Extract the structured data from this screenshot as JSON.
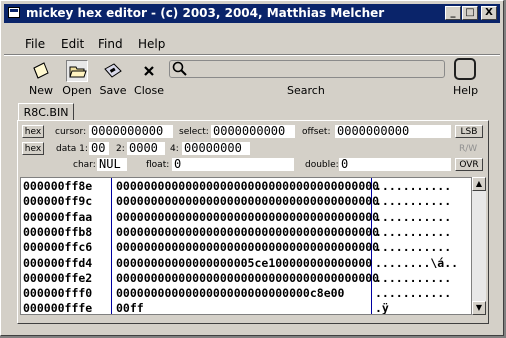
{
  "window": {
    "title": "mickey hex editor - (c) 2003, 2004, Matthias Melcher"
  },
  "title_buttons": [
    "_",
    "□",
    "X"
  ],
  "menu": [
    "File",
    "Edit",
    "Find",
    "Help"
  ],
  "toolbar": {
    "new": "New",
    "open": "Open",
    "save": "Save",
    "close": "Close",
    "search_label": "Search",
    "search_value": "",
    "help": "Help"
  },
  "tab": {
    "label": "R8C.BIN"
  },
  "fields": {
    "hex_button": "hex",
    "hex_button2": "hex",
    "cursor_label": "cursor:",
    "cursor_value": "0000000000",
    "select_label": "select:",
    "select_value": "0000000000",
    "offset_label": "offset:",
    "offset_value": "0000000000",
    "lsb": "LSB",
    "data1_label": "data 1:",
    "data1_value": "00",
    "data2_label": "2:",
    "data2_value": "0000",
    "data4_label": "4:",
    "data4_value": "00000000",
    "rw": "R/W",
    "char_label": "char:",
    "char_value": "NUL",
    "float_label": "float:",
    "float_value": "0",
    "double_label": "double:",
    "double_value": "0",
    "ovr": "OVR"
  },
  "hex": {
    "rows": [
      {
        "address": "000000ff8e",
        "bytes": "00000000000000000000000000000000000000",
        "ascii": "..........."
      },
      {
        "address": "000000ff9c",
        "bytes": "00000000000000000000000000000000000000",
        "ascii": "..........."
      },
      {
        "address": "000000ffaa",
        "bytes": "00000000000000000000000000000000000000",
        "ascii": "..........."
      },
      {
        "address": "000000ffb8",
        "bytes": "00000000000000000000000000000000000000",
        "ascii": "..........."
      },
      {
        "address": "000000ffc6",
        "bytes": "00000000000000000000000000000000000000",
        "ascii": "..........."
      },
      {
        "address": "000000ffd4",
        "bytes": "00000000000000000005ce100000000000000",
        "ascii": "........\\á.."
      },
      {
        "address": "000000ffe2",
        "bytes": "00000000000000000000000000000000000000",
        "ascii": "..........."
      },
      {
        "address": "000000fff0",
        "bytes": "0000000000000000000000000000c8e00",
        "ascii": "..........."
      },
      {
        "address": "000000fffe",
        "bytes": "00ff",
        "ascii": ".ÿ"
      }
    ]
  },
  "scroll": {
    "up": "▲",
    "down": "▼"
  }
}
